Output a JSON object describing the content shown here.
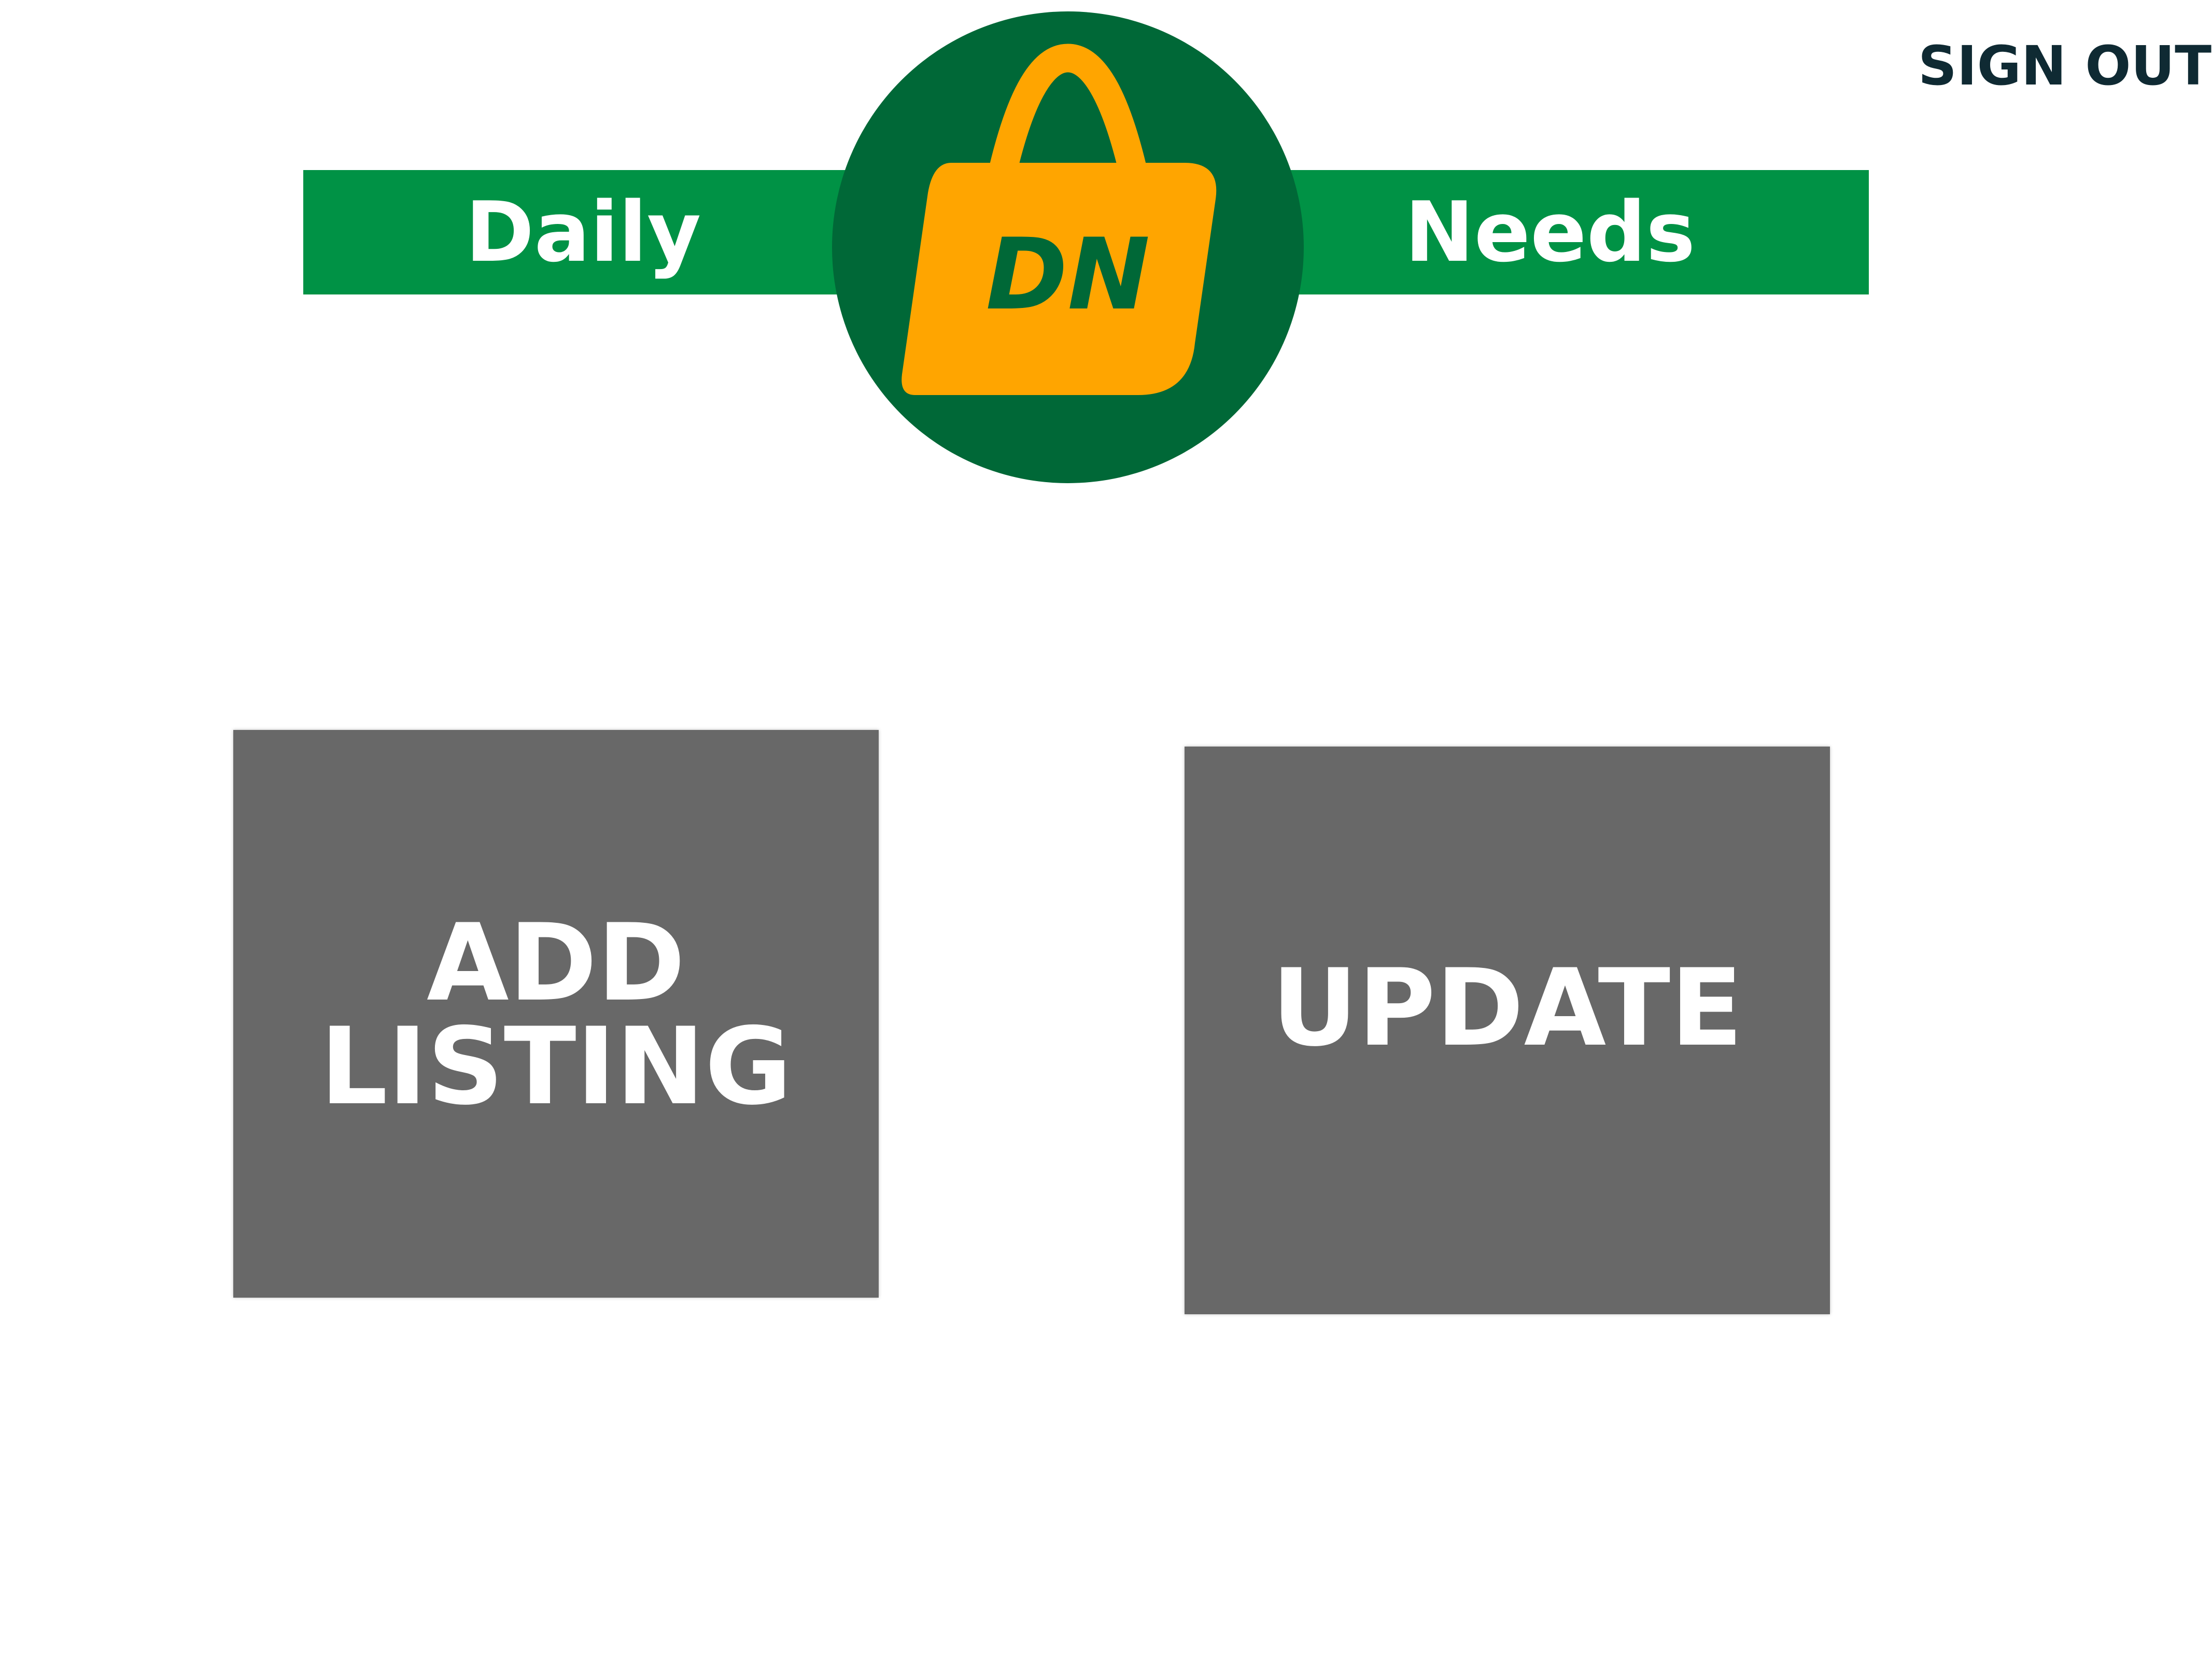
{
  "header": {
    "sign_out_label": "SIGN OUT"
  },
  "logo": {
    "left_word": "Daily",
    "right_word": "Needs",
    "initials": "DN",
    "icon": "shopping-bag-icon",
    "colors": {
      "banner_green": "#009245",
      "circle_green": "#006837",
      "bag_orange": "#FFA500",
      "text_white": "#FFFFFF"
    }
  },
  "actions": {
    "add_listing": {
      "line1": "ADD",
      "line2": "LISTING"
    },
    "update": {
      "label": "UPDATE"
    },
    "tile_color": "#686868"
  },
  "colors": {
    "sign_out_text": "#0F2A33",
    "background": "#FFFFFF"
  }
}
